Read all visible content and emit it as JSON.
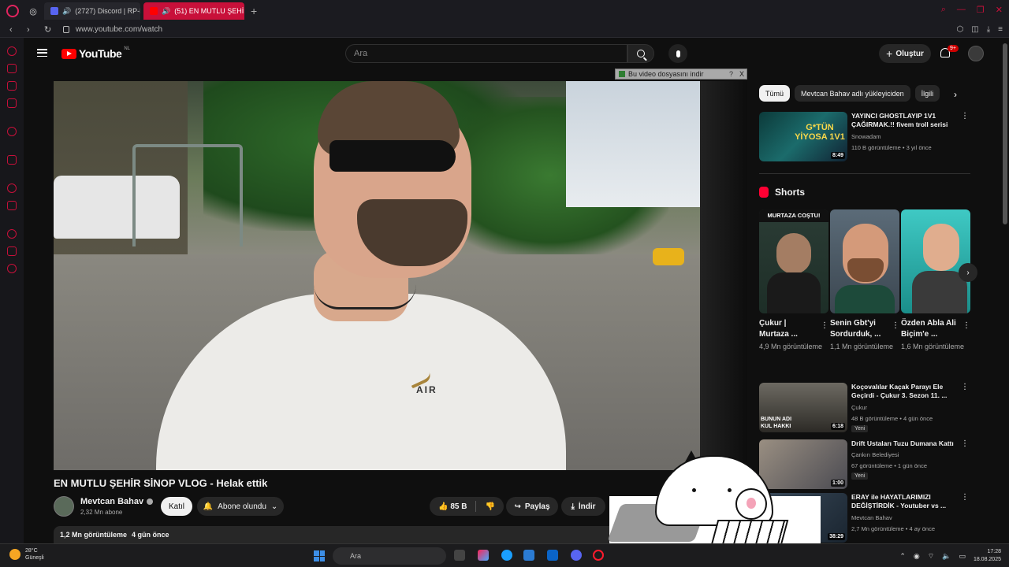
{
  "browser": {
    "tabs": [
      {
        "label": "(2727) Discord | RP-R",
        "active": false
      },
      {
        "label": "(51) EN MUTLU ŞEHİR",
        "active": true
      }
    ],
    "url": "www.youtube.com/watch",
    "accent_color": "#c8103a"
  },
  "youtube": {
    "logo_text": "YouTube",
    "region": "NL",
    "search_placeholder": "Ara",
    "create_label": "Oluştur",
    "notification_count": "9+"
  },
  "download_bar": {
    "label": "Bu video dosyasını indir",
    "help": "?",
    "close": "X"
  },
  "video": {
    "title": "EN MUTLU ŞEHİR SİNOP VLOG - Helak ettik",
    "channel": "Mevtcan Bahav",
    "subscribers": "2,32 Mn abone",
    "join_label": "Katıl",
    "subscribed_label": "Abone olundu",
    "likes": "85 B",
    "share_label": "Paylaş",
    "download_label": "İndir",
    "views": "1,2 Mn görüntüleme",
    "date": "4 gün önce",
    "shirt_brand": "AIR"
  },
  "chips": [
    {
      "label": "Tümü",
      "active": true
    },
    {
      "label": "Mevtcan Bahav adlı yükleyiciden",
      "active": false
    },
    {
      "label": "İlgili",
      "active": false
    }
  ],
  "recommendations_top": [
    {
      "title": "YAYINCI GHOSTLAYIP 1V1 ÇAĞIRMAK.!! fivem troll serisi",
      "channel": "Snowadam",
      "meta": "110 B görüntüleme • 3 yıl önce",
      "duration": "8:49",
      "thumb_text": "G*TÜN YİYOSA 1V1"
    }
  ],
  "shorts": {
    "header": "Shorts",
    "items": [
      {
        "title": "Çukur | Murtaza ...",
        "views": "4,9 Mn görüntüleme",
        "overlay": "MURTAZA COŞTU!"
      },
      {
        "title": "Senin Gbt'yi Sordurduk, ...",
        "views": "1,1 Mn görüntüleme",
        "overlay": ""
      },
      {
        "title": "Özden Abla Ali Biçim'e ...",
        "views": "1,6 Mn görüntüleme",
        "overlay": ""
      }
    ]
  },
  "recommendations": [
    {
      "title": "Koçovalılar Kaçak Parayı Ele Geçirdi - Çukur 3. Sezon 11. ...",
      "channel": "Çukur",
      "meta": "48 B görüntüleme • 4 gün önce",
      "badge": "Yeni",
      "duration": "6:18",
      "thumb_text": "BUNUN ADI KUL HAKKI"
    },
    {
      "title": "Drift Ustaları Tuzu Dumana Kattı",
      "channel": "Çankırı Belediyesi",
      "meta": "67 görüntüleme • 1 gün önce",
      "badge": "Yeni",
      "duration": "1:00",
      "thumb_text": ""
    },
    {
      "title": "ERAY ile HAYATLARIMIZI DEĞİŞTİRDİK - Youtuber vs ...",
      "channel": "Mevtcan Bahav",
      "meta": "2,7 Mn görüntüleme • 4 ay önce",
      "badge": "",
      "duration": "38:29",
      "thumb_text": ""
    }
  ],
  "taskbar": {
    "weather_temp": "28°C",
    "weather_desc": "Güneşli",
    "search_placeholder": "Ara",
    "time": "17:28",
    "date": "18.08.2025"
  }
}
